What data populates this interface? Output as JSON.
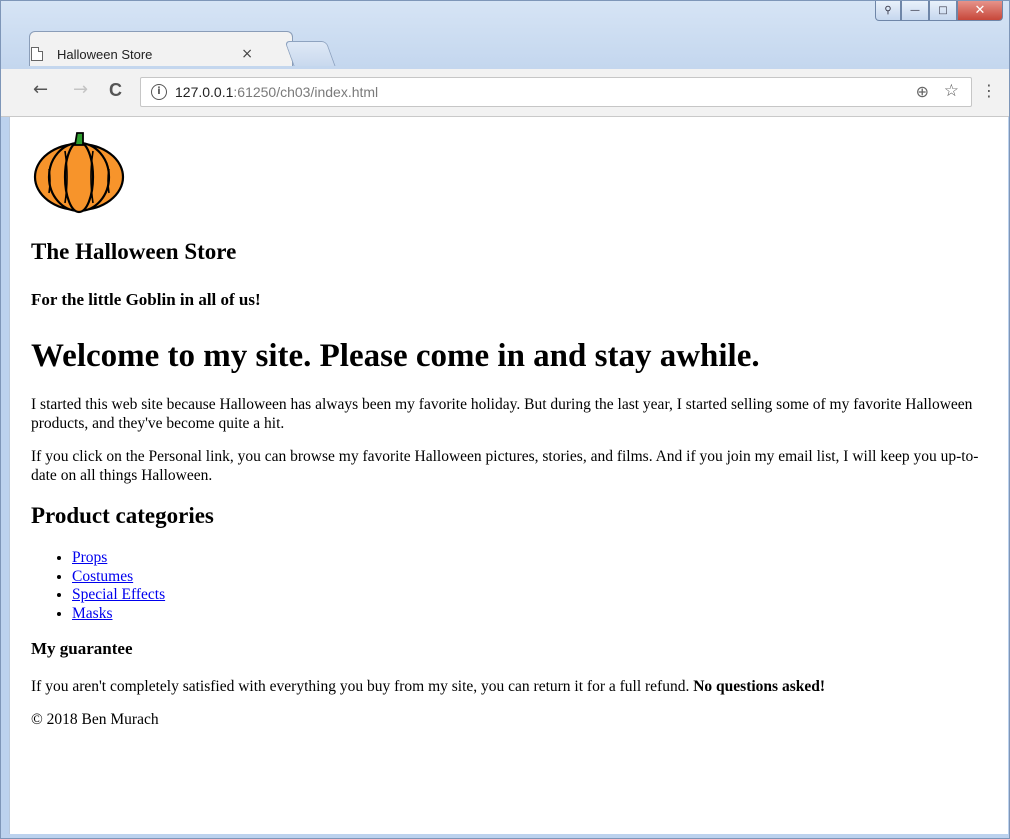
{
  "browser": {
    "tab_title": "Halloween Store",
    "tab_close": "×",
    "url_host": "127.0.0.1",
    "url_rest": ":61250/ch03/index.html",
    "info_icon": "ⓘ",
    "back_icon": "←",
    "forward_icon": "→",
    "reload_icon": "C",
    "zoom_icon": "⊕",
    "star_icon": "☆",
    "menu_icon": "⋮",
    "minimize": "—",
    "maximize": "□",
    "close": "✕",
    "user": "⚲"
  },
  "page": {
    "store_name": "The Halloween Store",
    "tagline": "For the little Goblin in all of us!",
    "welcome": "Welcome to my site. Please come in and stay awhile.",
    "intro": "I started this web site because Halloween has always been my favorite holiday. But during the last year, I started selling some of my favorite Halloween products, and they've become quite a hit.",
    "personal": "If you click on the Personal link, you can browse my favorite Halloween pictures, stories, and films. And if you join my email list, I will keep you up-to-date on all things Halloween.",
    "categories_heading": "Product categories",
    "categories": [
      "Props",
      "Costumes",
      "Special Effects",
      "Masks"
    ],
    "guarantee_heading": "My guarantee",
    "guarantee_text": "If you aren't completely satisfied with everything you buy from my site, you can return it for a full refund. ",
    "guarantee_bold": "No questions asked!",
    "copyright": "© 2018 Ben Murach"
  },
  "colors": {
    "link": "#0000ee",
    "pumpkin": "#f7942b"
  }
}
